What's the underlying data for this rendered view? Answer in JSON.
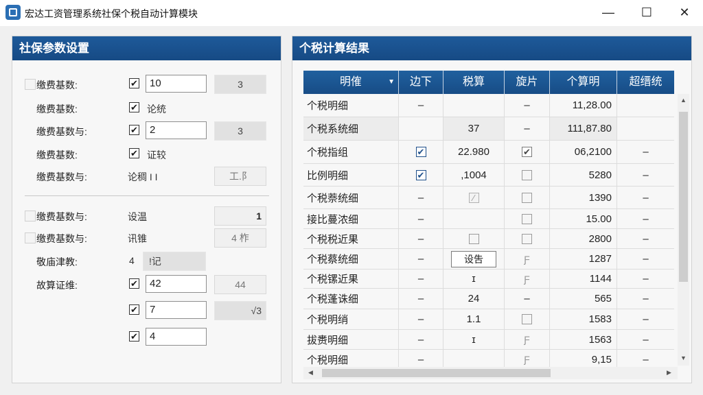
{
  "window": {
    "title": "宏达工资管理系统社保个税自动计算模块",
    "minimize_glyph": "—",
    "maximize_glyph": "☐",
    "close_glyph": "✕",
    "icon": "app-logo-icon"
  },
  "left_panel": {
    "title": "社保参数设置",
    "rows": [
      {
        "label": "缴费基数:",
        "checked": true,
        "input_value": "10",
        "side_value": "3"
      },
      {
        "label": "缴费基数:",
        "checked": true,
        "text": "论统"
      },
      {
        "label": "缴费基数与:",
        "checked": true,
        "input_value": "2",
        "side_value": "3"
      },
      {
        "label": "缴费基数:",
        "checked": true,
        "text": "证较"
      },
      {
        "label": "缴费基数与:",
        "plain_text": "论稠 I  I",
        "side_value": "工.阝"
      },
      {
        "label": "缴费基数与:",
        "plain_text": "设温",
        "side_value": "1"
      },
      {
        "label": "缴费基数与:",
        "plain_text": "讯锥",
        "side_value": "4 柞"
      },
      {
        "label": "敬庙津教:",
        "plain_text": "4",
        "side_value": "!记"
      },
      {
        "label": "故算证维:",
        "checked": true,
        "input_value": "42",
        "side_value": "44"
      },
      {
        "checked": true,
        "input_value": "7",
        "side_value": "√3"
      },
      {
        "checked": true,
        "input_value": "4"
      }
    ]
  },
  "right_panel": {
    "title": "个税计算结果",
    "columns": [
      "明傕",
      "边下",
      "税算",
      "旋片",
      "个算明",
      "超缙统"
    ],
    "sort_glyph": "▼",
    "rows": [
      {
        "name": "个税明细",
        "c2": "–",
        "c3": "",
        "c4": "–",
        "amount": "11,28.00",
        "c6": ""
      },
      {
        "name": "个税系统细",
        "c2": "",
        "c3": "37",
        "c4": "–",
        "amount": "111,87.80",
        "c6": ""
      },
      {
        "name": "个税指组",
        "c2": "✔",
        "c3": "22.980",
        "c4": "✔",
        "amount": "06,2100",
        "c6": "–"
      },
      {
        "name": "比例明细",
        "c2": "✔",
        "c3": ",1004",
        "c4": "",
        "amount": "5280",
        "c6": "–"
      },
      {
        "name": "个税萘统细",
        "c2": "–",
        "c3": "∕",
        "c4": "",
        "amount": "1390",
        "c6": "–"
      },
      {
        "name": "接比蔓浓细",
        "c2": "–",
        "c3": "",
        "c4": "",
        "amount": "15.00",
        "c6": "–"
      },
      {
        "name": "个税税近果",
        "c2": "–",
        "c3": "",
        "c4": "",
        "amount": "2800",
        "c6": "–"
      },
      {
        "name": "个税蔡统细",
        "c2": "–",
        "c3": "设吿",
        "c4": "Ƒ",
        "amount": "1287",
        "c6": "–"
      },
      {
        "name": "个税镙近果",
        "c2": "–",
        "c3": "ɪ",
        "c4": "Ƒ",
        "amount": "1144",
        "c6": "–"
      },
      {
        "name": "个税蓬诛细",
        "c2": "–",
        "c3": "24",
        "c4": "–",
        "amount": "565",
        "c6": "–"
      },
      {
        "name": "个税明绡",
        "c2": "–",
        "c3": "1.1",
        "c4": "",
        "amount": "1583",
        "c6": "–"
      },
      {
        "name": "拔赉明细",
        "c2": "–",
        "c3": "ɪ",
        "c4": "Ƒ",
        "amount": "1563",
        "c6": "–"
      },
      {
        "name": "个税明细",
        "c2": "–",
        "c3": "",
        "c4": "Ƒ",
        "amount": "9,15",
        "c6": "–"
      }
    ]
  },
  "scrollbars": {
    "up": "▲",
    "down": "▼",
    "left": "◀",
    "right": "▶"
  }
}
